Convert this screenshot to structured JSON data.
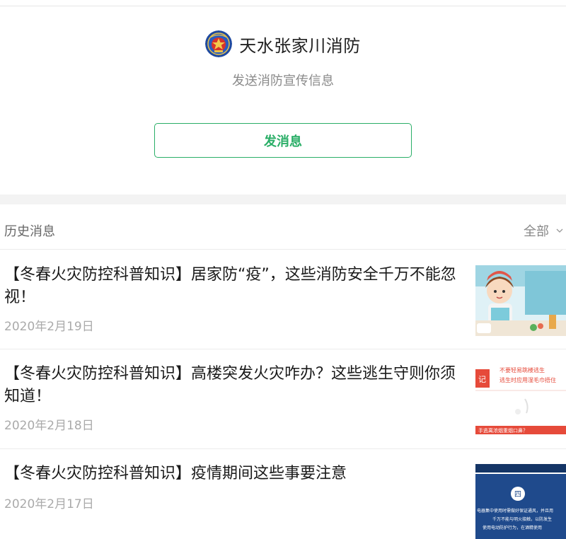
{
  "account": {
    "name": "天水张家川消防",
    "description": "发送消防宣传信息",
    "send_button_label": "发消息"
  },
  "history": {
    "title": "历史消息",
    "filter_label": "全部",
    "messages": [
      {
        "title": "【冬春火灾防控科普知识】居家防“疫”，这些消防安全千万不能忽视！",
        "date": "2020年2月19日"
      },
      {
        "title": "【冬春火灾防控科普知识】高楼突发火灾咋办？这些逃生守则你须知道！",
        "date": "2020年2月18日"
      },
      {
        "title": "【冬春火灾防控科普知识】疫情期间这些事要注意",
        "date": "2020年2月17日"
      }
    ]
  },
  "thumbnail_text": {
    "thumb2_line1": "不要轻易跳楼逃生",
    "thumb2_line2": "逃生时应用湿毛巾捂住",
    "thumb2_badge": "记",
    "thumb2_bottom": "手逃离浓烟重烟口鼻？",
    "thumb3_badge": "四",
    "thumb3_line1": "电器集中使用时需做好保证通风，并且用",
    "thumb3_line2": "千万不能与明火接触，以防发生",
    "thumb3_line3": "使用电动防护行为，在酒精使用"
  },
  "colors": {
    "accent_green": "#2aae67",
    "thumb3_navy": "#1f4a8c"
  }
}
